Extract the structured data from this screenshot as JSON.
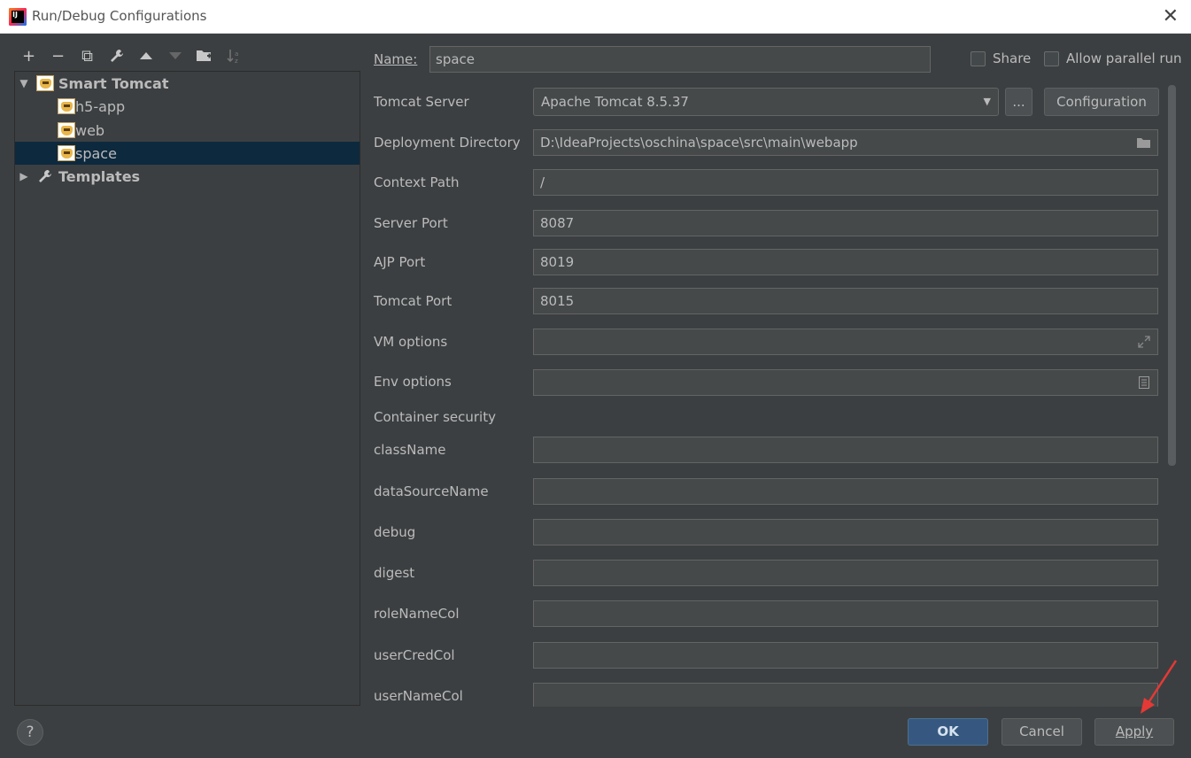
{
  "window": {
    "title": "Run/Debug Configurations",
    "close_glyph": "✕",
    "app_icon_text": "IJ"
  },
  "toolbar": [
    {
      "name": "add-icon",
      "glyph": "+"
    },
    {
      "name": "remove-icon",
      "glyph": "−"
    },
    {
      "name": "copy-icon",
      "glyph": "⧉"
    },
    {
      "name": "wrench-icon",
      "glyph": "🔧"
    },
    {
      "name": "move-up-icon",
      "glyph": "▲"
    },
    {
      "name": "move-down-icon",
      "glyph": "▼"
    },
    {
      "name": "new-folder-icon",
      "glyph": "📁"
    },
    {
      "name": "sort-icon",
      "glyph": "↓a"
    }
  ],
  "tree": {
    "root": {
      "label": "Smart Tomcat",
      "arrow": "▼",
      "icon": "tomcat-icon"
    },
    "children": [
      "h5-app",
      "web",
      "space"
    ],
    "selected": "space",
    "templates": {
      "label": "Templates",
      "arrow": "▶",
      "icon": "wrench-icon"
    }
  },
  "form": {
    "name_label": "Name:",
    "name_value": "space",
    "share_label": "Share",
    "parallel_label": "Allow parallel run",
    "tomcat_server": {
      "label": "Tomcat Server",
      "value": "Apache Tomcat 8.5.37",
      "browse": "...",
      "configuration": "Configuration"
    },
    "deployment_directory": {
      "label": "Deployment Directory",
      "value": "D:\\IdeaProjects\\oschina\\space\\src\\main\\webapp",
      "icon": "folder-icon"
    },
    "context_path": {
      "label": "Context Path",
      "value": "/"
    },
    "server_port": {
      "label": "Server Port",
      "value": "8087"
    },
    "ajp_port": {
      "label": "AJP Port",
      "value": "8019"
    },
    "tomcat_port": {
      "label": "Tomcat Port",
      "value": "8015"
    },
    "vm_options": {
      "label": "VM options",
      "value": "",
      "icon": "expand-icon"
    },
    "env_options": {
      "label": "Env options",
      "value": "",
      "icon": "document-icon"
    },
    "container_security": "Container security",
    "security_fields": [
      {
        "label": "className",
        "value": ""
      },
      {
        "label": "dataSourceName",
        "value": ""
      },
      {
        "label": "debug",
        "value": ""
      },
      {
        "label": "digest",
        "value": ""
      },
      {
        "label": "roleNameCol",
        "value": ""
      },
      {
        "label": "userCredCol",
        "value": ""
      },
      {
        "label": "userNameCol",
        "value": ""
      }
    ]
  },
  "footer": {
    "help": "?",
    "ok": "OK",
    "cancel": "Cancel",
    "apply": "Apply"
  },
  "colors": {
    "background": "#3c3f41",
    "selected": "#0d293e",
    "ok_button": "#365880",
    "annotation_arrow": "#e53935"
  }
}
